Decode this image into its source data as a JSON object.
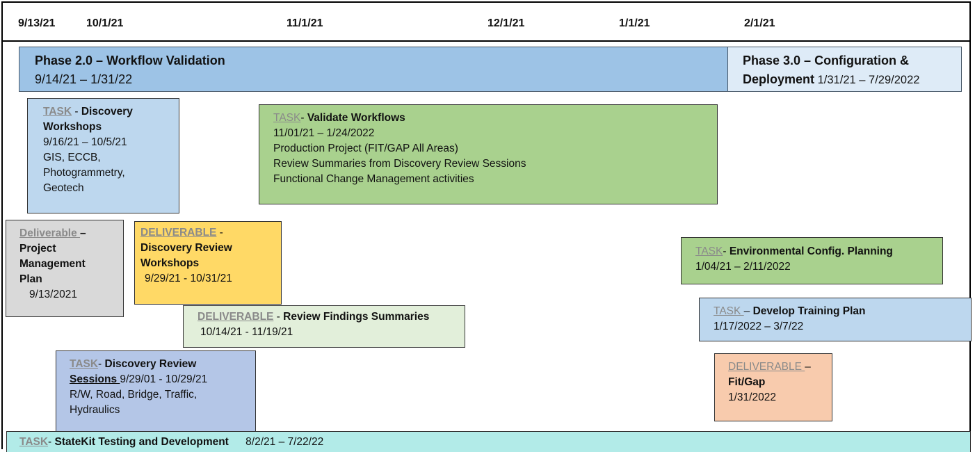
{
  "dates": [
    "9/13/21",
    "10/1/21",
    "11/1/21",
    "12/1/21",
    "1/1/21",
    "2/1/21"
  ],
  "phase2": {
    "title": "Phase 2.0 – Workflow Validation",
    "dates": "9/14/21 – 1/31/22"
  },
  "phase3": {
    "title_1": "Phase 3.0 – Configuration &",
    "title_2": "Deployment",
    "dates": "1/31/21 – 7/29/2022"
  },
  "discovery_workshops": {
    "label": "TASK",
    "sep": " - ",
    "title_1": "Discovery",
    "title_2": "Workshops",
    "dates": "9/16/21 – 10/5/21",
    "line_1": "GIS, ECCB,",
    "line_2": "Photogrammetry,",
    "line_3": "Geotech"
  },
  "validate_workflows": {
    "label": "TASK",
    "sep": "- ",
    "title": "Validate Workflows",
    "dates": "11/01/21 – 1/24/2022",
    "line_1": "Production Project (FIT/GAP All Areas)",
    "line_2": "Review Summaries from Discovery Review Sessions",
    "line_3": "Functional Change Management activities"
  },
  "pm_plan": {
    "label": "Deliverable ",
    "sep": " –",
    "title_1": "Project",
    "title_2": "Management",
    "title_3": "Plan",
    "date": "9/13/2021"
  },
  "discovery_review_workshops": {
    "label": "DELIVERABLE",
    "sep": " -",
    "title_1": "Discovery Review",
    "title_2": "Workshops",
    "dates": "9/29/21 - 10/31/21"
  },
  "review_findings": {
    "label": "DELIVERABLE",
    "sep": " - ",
    "title": "Review Findings Summaries",
    "dates": "10/14/21 - 11/19/21"
  },
  "env_config": {
    "label": "TASK",
    "sep": "- ",
    "title": "Environmental Config. Planning",
    "dates": "1/04/21 – 2/11/2022"
  },
  "training_plan": {
    "label": "TASK ",
    "sep": "– ",
    "title": "Develop Training Plan",
    "dates": "1/17/2022 – 3/7/22"
  },
  "discovery_review_sessions": {
    "label": "TASK",
    "sep": "- ",
    "title_1": "Discovery Review",
    "title_2": "Sessions ",
    "dates": "9/29/01 - 10/29/21",
    "line_1": "R/W, Road, Bridge, Traffic,",
    "line_2": "Hydraulics"
  },
  "fit_gap": {
    "label": "DELIVERABLE ",
    "sep": "–",
    "title": "Fit/Gap",
    "date": "1/31/2022"
  },
  "statekit": {
    "label": "TASK",
    "sep": "- ",
    "title": "StateKit Testing and Development",
    "dates": "8/2/21 – 7/22/22"
  },
  "colors": {
    "phase2": "#9dc3e6",
    "phase3": "#deebf7",
    "task_blue": "#bdd7ee",
    "green": "#a9d18e",
    "grey": "#d9d9d9",
    "yellow": "#ffd966",
    "light_green": "#e2efda",
    "periwinkle": "#b4c6e7",
    "peach": "#f8cbad",
    "teal": "#b2ebe8"
  }
}
